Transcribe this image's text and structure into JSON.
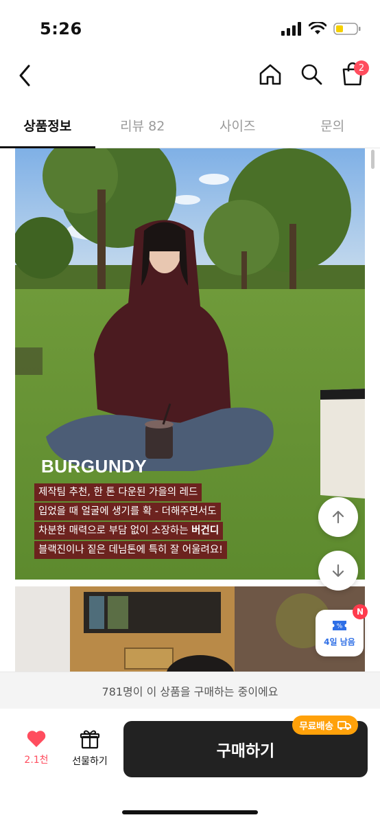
{
  "status_bar": {
    "time": "5:26"
  },
  "nav": {
    "cart_count": "2"
  },
  "tabs": [
    {
      "label": "상품정보",
      "active": true
    },
    {
      "label": "리뷰 82",
      "active": false
    },
    {
      "label": "사이즈",
      "active": false
    },
    {
      "label": "문의",
      "active": false
    }
  ],
  "product": {
    "color_title": "BURGUNDY",
    "caption_lines": [
      "제작팀 추천, 한 톤 다운된 가을의 레드",
      "입었을 때 얼굴에 생기를 확 - 더해주면서도",
      "차분한 매력으로 부담 없이 소장하는",
      "버건디",
      "블랙진이나 짙은 데님톤에 특히 잘 어울려요!"
    ]
  },
  "coupon": {
    "badge": "N",
    "label": "4일 남음"
  },
  "buying_notice": "781명이 이 상품을 구매하는 중이에요",
  "bottom": {
    "like_count": "2.1천",
    "gift_label": "선물하기",
    "buy_label": "구매하기",
    "free_shipping": "무료배송"
  },
  "colors": {
    "accent_red": "#ff4d5e",
    "caption_bg": "#6e141c",
    "buy_button": "#222222",
    "free_ship": "#ffa10a",
    "coupon_blue": "#2f6fe6"
  }
}
